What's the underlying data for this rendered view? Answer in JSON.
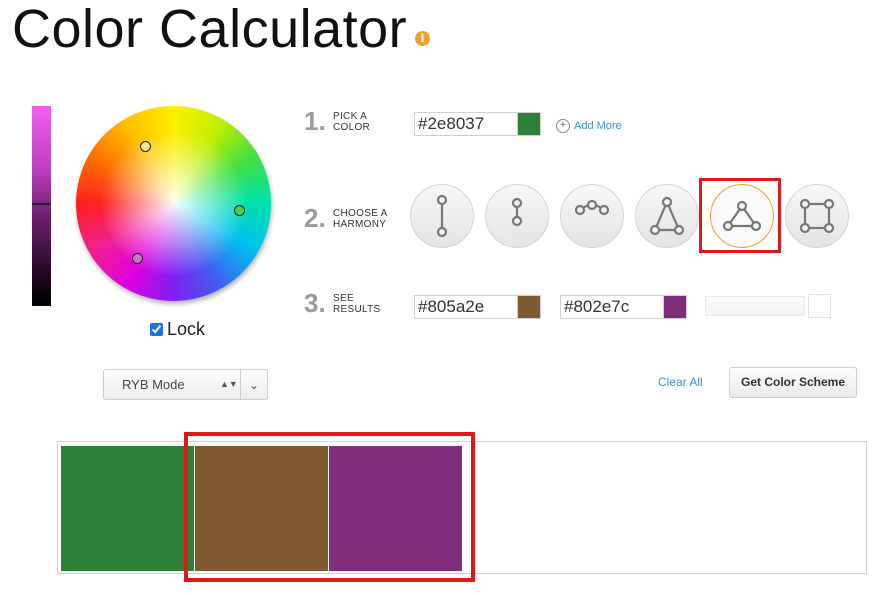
{
  "header": {
    "title": "Color Calculator",
    "info_glyph": "i"
  },
  "wheel": {
    "lock_label": "Lock",
    "lock_checked": true
  },
  "steps": {
    "step1": {
      "num": "1.",
      "line1": "PICK A",
      "line2": "COLOR"
    },
    "step2": {
      "num": "2.",
      "line1": "CHOOSE A",
      "line2": "HARMONY"
    },
    "step3": {
      "num": "3.",
      "line1": "SEE",
      "line2": "RESULTS"
    }
  },
  "pick": {
    "hex": "#2e8037",
    "add_more": "Add More",
    "plus_glyph": "+"
  },
  "harmonies": {
    "selected": "triad",
    "icons": [
      "complementary-icon",
      "split-complementary-icon",
      "analogous-icon",
      "triangle-icon",
      "triad-icon",
      "square-icon"
    ]
  },
  "results": [
    {
      "hex": "#805a2e"
    },
    {
      "hex": "#802e7c"
    }
  ],
  "controls": {
    "mode_label": "RYB Mode",
    "updown_glyph": "▲▼",
    "chevron_glyph": "⌄",
    "clear_all": "Clear All",
    "get_scheme": "Get Color Scheme"
  },
  "scheme_colors": [
    "#2e8037",
    "#805a2e",
    "#802e7c"
  ],
  "colors": {
    "accent_link": "#3a8fd0",
    "highlight": "#e01818",
    "selected_ring": "#f0a030"
  }
}
